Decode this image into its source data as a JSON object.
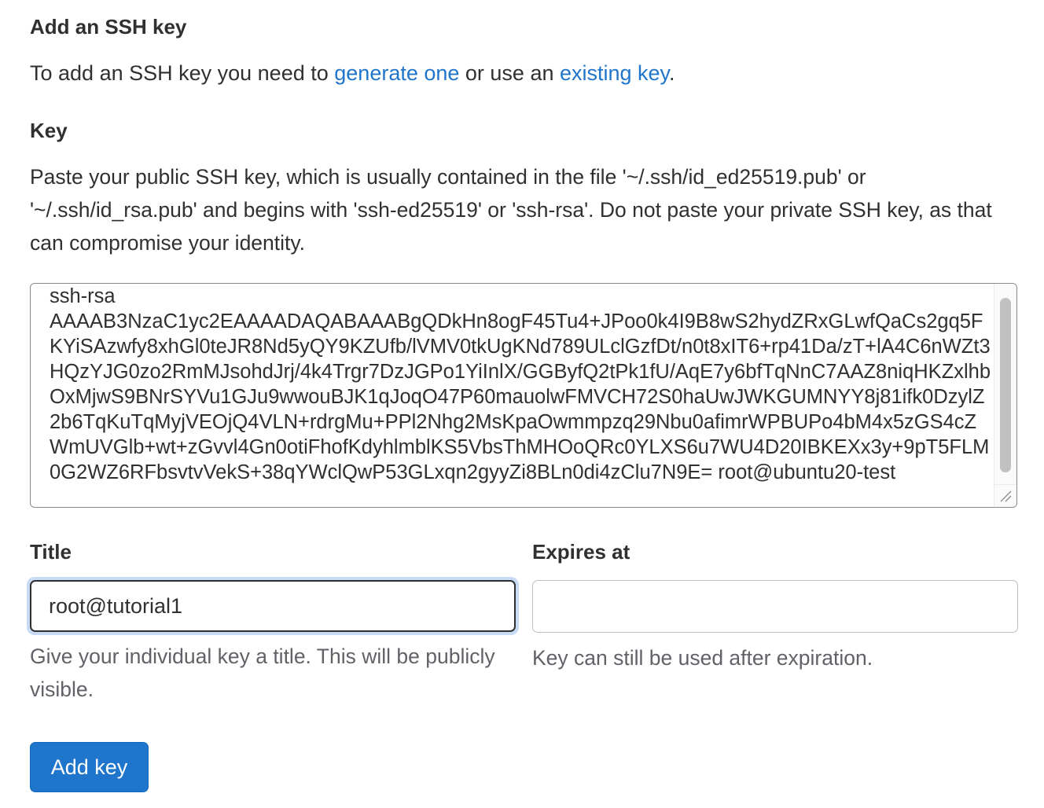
{
  "section": {
    "heading": "Add an SSH key",
    "intro_prefix": "To add an SSH key you need to ",
    "link_generate": "generate one",
    "intro_middle": " or use an ",
    "link_existing": "existing key",
    "intro_suffix": "."
  },
  "key": {
    "label": "Key",
    "description": "Paste your public SSH key, which is usually contained in the file '~/.ssh/id_ed25519.pub' or '~/.ssh/id_rsa.pub' and begins with 'ssh-ed25519' or 'ssh-rsa'. Do not paste your private SSH key, as that can compromise your identity.",
    "value": "ssh-rsa\nAAAAB3NzaC1yc2EAAAADAQABAAABgQDkHn8ogF45Tu4+JPoo0k4I9B8wS2hydZRxGLwfQaCs2gq5FKYiSAzwfy8xhGl0teJR8Nd5yQY9KZUfb/lVMV0tkUgKNd789ULclGzfDt/n0t8xIT6+rp41Da/zT+lA4C6nWZt3HQzYJG0zo2RmMJsohdJrj/4k4Trgr7DzJGPo1YiInlX/GGByfQ2tPk1fU/AqE7y6bfTqNnC7AAZ8niqHKZxlhbOxMjwS9BNrSYVu1GJu9wwouBJK1qJoqO47P60mauolwFMVCH72S0haUwJWKGUMNYY8j81ifk0DzylZ2b6TqKuTqMyjVEOjQ4VLN+rdrgMu+PPl2Nhg2MsKpaOwmmpzq29Nbu0afimrWPBUPo4bM4x5zGS4cZWmUVGlb+wt+zGvvl4Gn0otiFhofKdyhlmblKS5VbsThMHOoQRc0YLXS6u7WU4D20IBKEXx3y+9pT5FLM0G2WZ6RFbsvtvVekS+38qYWclQwP53GLxqn2gyyZi8BLn0di4zClu7N9E= root@ubuntu20-test"
  },
  "title": {
    "label": "Title",
    "value": "root@tutorial1",
    "help": "Give your individual key a title. This will be publicly visible."
  },
  "expires": {
    "label": "Expires at",
    "value": "",
    "help": "Key can still be used after expiration."
  },
  "submit": {
    "label": "Add key"
  },
  "colors": {
    "link": "#1f75cb",
    "button_bg": "#1f75cb",
    "focus_ring": "#c7dbf5"
  }
}
